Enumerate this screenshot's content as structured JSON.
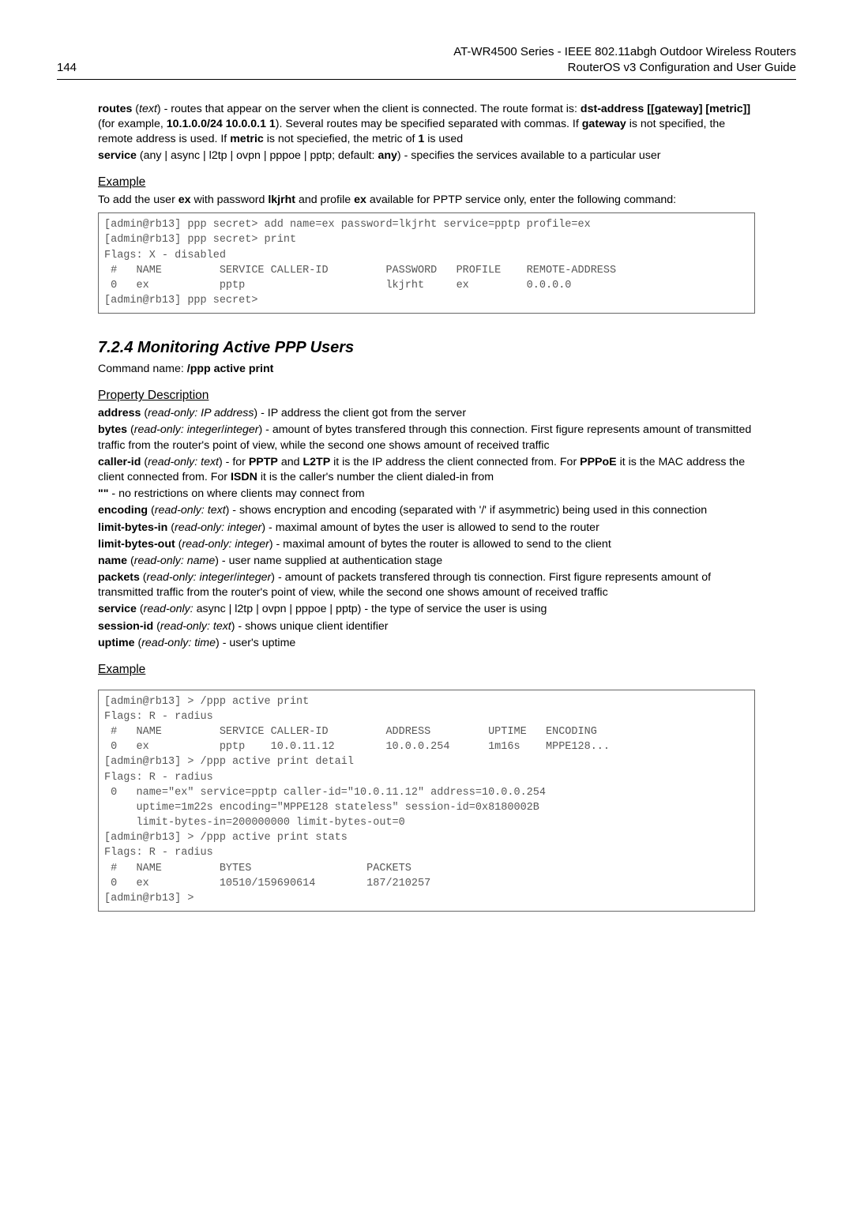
{
  "header": {
    "page_number": "144",
    "line1": "AT-WR4500 Series - IEEE 802.11abgh Outdoor Wireless Routers",
    "line2": "RouterOS v3 Configuration and User Guide"
  },
  "intro": {
    "routes_prop": "routes",
    "routes_type": "text",
    "routes_desc1": ") - routes that appear on the server when the client is connected. The route format is: ",
    "routes_fmt": "dst-address [[gateway] [metric]]",
    "routes_desc2": " (for example, ",
    "routes_example": "10.1.0.0/24 10.0.0.1 1",
    "routes_desc3": "). Several routes may be specified separated with commas. If ",
    "gateway": "gateway",
    "routes_desc4": " is not specified, the remote address is used. If ",
    "metric": "metric",
    "routes_desc5": " is not speciefied, the metric of ",
    "one": "1",
    "routes_desc6": " is used",
    "service_prop": "service",
    "service_vals": " (any | async | l2tp | ovpn | pppoe | pptp; default: ",
    "service_default": "any",
    "service_desc": ") - specifies the services available to a particular user"
  },
  "example1": {
    "heading": "Example",
    "intro1": "To add the user ",
    "user": "ex",
    "intro2": " with password ",
    "pwd": "lkjrht",
    "intro3": " and profile ",
    "profile": "ex",
    "intro4": " available for PPTP service only, enter the following command:",
    "code": "[admin@rb13] ppp secret> add name=ex password=lkjrht service=pptp profile=ex\n[admin@rb13] ppp secret> print\nFlags: X - disabled\n #   NAME         SERVICE CALLER-ID         PASSWORD   PROFILE    REMOTE-ADDRESS\n 0   ex           pptp                      lkjrht     ex         0.0.0.0\n[admin@rb13] ppp secret>"
  },
  "section": {
    "heading": "7.2.4  Monitoring Active PPP Users",
    "cmd_label": "Command name: ",
    "cmd": "/ppp active print"
  },
  "propdesc": {
    "heading": "Property Description",
    "address_p": "address",
    "address_t": "read-only: IP address",
    "address_d": ") - IP address the client got from the server",
    "bytes_p": "bytes",
    "bytes_t": "read-only: integer",
    "bytes_sep": "/",
    "bytes_t2": "integer",
    "bytes_d": ") - amount of bytes transfered through this connection. First figure represents amount of transmitted traffic from the router's point of view, while the second one shows amount of received traffic",
    "caller_p": "caller-id",
    "caller_t": "read-only: text",
    "caller_d1": ") - for ",
    "pptp": "PPTP",
    "and": " and ",
    "l2tp": "L2TP",
    "caller_d2": " it is the IP address the client connected from. For ",
    "pppoe": "PPPoE",
    "caller_d3": " it is the MAC address the client connected from. For ",
    "isdn": "ISDN",
    "caller_d4": " it is the caller's number the client dialed-in from",
    "empty_p": "\"\"",
    "empty_d": " - no restrictions on where clients may connect from",
    "encoding_p": "encoding",
    "encoding_t": "read-only: text",
    "encoding_d": ") - shows encryption and encoding (separated with '/' if asymmetric) being used in this connection",
    "lbi_p": "limit-bytes-in",
    "lbi_t": "read-only: integer",
    "lbi_d": ") - maximal amount of bytes the user is allowed to send to the router",
    "lbo_p": "limit-bytes-out",
    "lbo_t": "read-only: integer",
    "lbo_d": ") - maximal amount of bytes the router is allowed to send to the client",
    "name_p": "name",
    "name_t": "read-only: name",
    "name_d": ") - user name supplied at authentication stage",
    "packets_p": "packets",
    "packets_t": "read-only: integer",
    "packets_t2": "integer",
    "packets_d": ") - amount of packets transfered through tis connection. First figure represents amount of transmitted traffic from the router's point of view, while the second one shows amount of received traffic",
    "service_p": "service",
    "service_t": "read-only:",
    "service_vals": " async | l2tp | ovpn | pppoe | pptp) - the type of service the user is using",
    "session_p": "session-id",
    "session_t": "read-only: text",
    "session_d": ") - shows unique client identifier",
    "uptime_p": "uptime",
    "uptime_t": "read-only: time",
    "uptime_d": ") - user's uptime"
  },
  "example2": {
    "heading": "Example",
    "code": "[admin@rb13] > /ppp active print\nFlags: R - radius\n #   NAME         SERVICE CALLER-ID         ADDRESS         UPTIME   ENCODING\n 0   ex           pptp    10.0.11.12        10.0.0.254      1m16s    MPPE128...\n[admin@rb13] > /ppp active print detail\nFlags: R - radius\n 0   name=\"ex\" service=pptp caller-id=\"10.0.11.12\" address=10.0.0.254\n     uptime=1m22s encoding=\"MPPE128 stateless\" session-id=0x8180002B\n     limit-bytes-in=200000000 limit-bytes-out=0\n[admin@rb13] > /ppp active print stats\nFlags: R - radius\n #   NAME         BYTES                  PACKETS\n 0   ex           10510/159690614        187/210257\n[admin@rb13] >"
  }
}
